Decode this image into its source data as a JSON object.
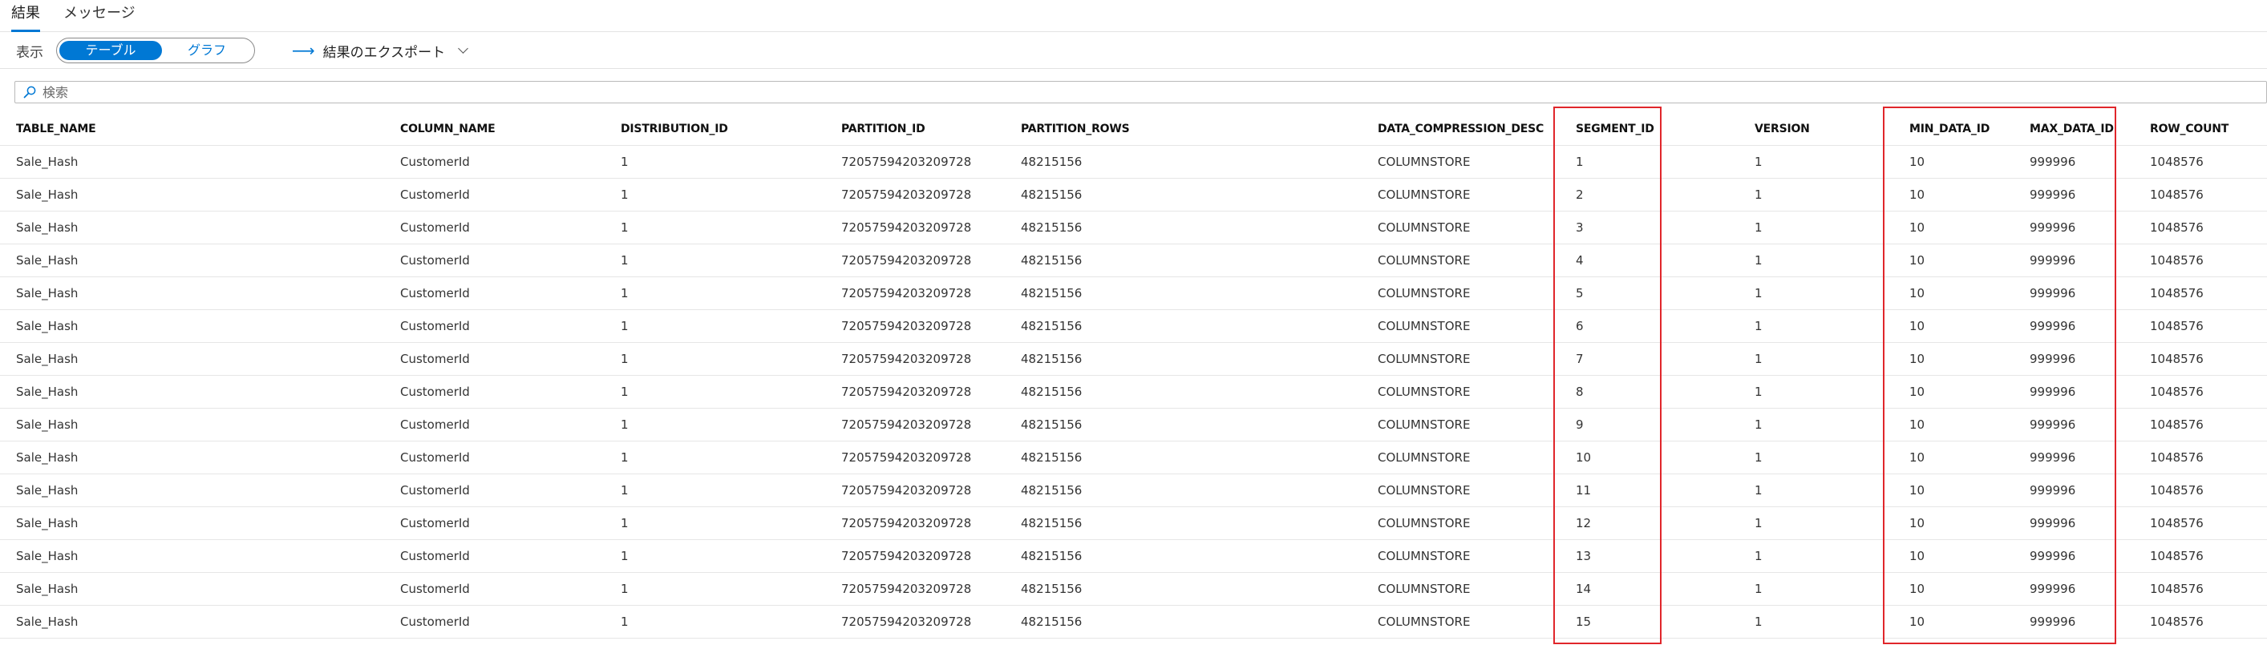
{
  "tabs": {
    "results": "結果",
    "messages": "メッセージ"
  },
  "view": {
    "label": "表示",
    "table_option": "テーブル",
    "chart_option": "グラフ",
    "export_label": "結果のエクスポート"
  },
  "search": {
    "placeholder": "検索"
  },
  "colors": {
    "accent": "#0078d4",
    "highlight": "#e0262b"
  },
  "table": {
    "columns": [
      "TABLE_NAME",
      "COLUMN_NAME",
      "DISTRIBUTION_ID",
      "PARTITION_ID",
      "PARTITION_ROWS",
      "DATA_COMPRESSION_DESC",
      "SEGMENT_ID",
      "VERSION",
      "MIN_DATA_ID",
      "MAX_DATA_ID",
      "ROW_COUNT"
    ],
    "highlighted_columns": [
      "SEGMENT_ID",
      "MIN_DATA_ID",
      "MAX_DATA_ID"
    ],
    "rows": [
      [
        "Sale_Hash",
        "CustomerId",
        "1",
        "72057594203209728",
        "48215156",
        "COLUMNSTORE",
        "1",
        "1",
        "10",
        "999996",
        "1048576"
      ],
      [
        "Sale_Hash",
        "CustomerId",
        "1",
        "72057594203209728",
        "48215156",
        "COLUMNSTORE",
        "2",
        "1",
        "10",
        "999996",
        "1048576"
      ],
      [
        "Sale_Hash",
        "CustomerId",
        "1",
        "72057594203209728",
        "48215156",
        "COLUMNSTORE",
        "3",
        "1",
        "10",
        "999996",
        "1048576"
      ],
      [
        "Sale_Hash",
        "CustomerId",
        "1",
        "72057594203209728",
        "48215156",
        "COLUMNSTORE",
        "4",
        "1",
        "10",
        "999996",
        "1048576"
      ],
      [
        "Sale_Hash",
        "CustomerId",
        "1",
        "72057594203209728",
        "48215156",
        "COLUMNSTORE",
        "5",
        "1",
        "10",
        "999996",
        "1048576"
      ],
      [
        "Sale_Hash",
        "CustomerId",
        "1",
        "72057594203209728",
        "48215156",
        "COLUMNSTORE",
        "6",
        "1",
        "10",
        "999996",
        "1048576"
      ],
      [
        "Sale_Hash",
        "CustomerId",
        "1",
        "72057594203209728",
        "48215156",
        "COLUMNSTORE",
        "7",
        "1",
        "10",
        "999996",
        "1048576"
      ],
      [
        "Sale_Hash",
        "CustomerId",
        "1",
        "72057594203209728",
        "48215156",
        "COLUMNSTORE",
        "8",
        "1",
        "10",
        "999996",
        "1048576"
      ],
      [
        "Sale_Hash",
        "CustomerId",
        "1",
        "72057594203209728",
        "48215156",
        "COLUMNSTORE",
        "9",
        "1",
        "10",
        "999996",
        "1048576"
      ],
      [
        "Sale_Hash",
        "CustomerId",
        "1",
        "72057594203209728",
        "48215156",
        "COLUMNSTORE",
        "10",
        "1",
        "10",
        "999996",
        "1048576"
      ],
      [
        "Sale_Hash",
        "CustomerId",
        "1",
        "72057594203209728",
        "48215156",
        "COLUMNSTORE",
        "11",
        "1",
        "10",
        "999996",
        "1048576"
      ],
      [
        "Sale_Hash",
        "CustomerId",
        "1",
        "72057594203209728",
        "48215156",
        "COLUMNSTORE",
        "12",
        "1",
        "10",
        "999996",
        "1048576"
      ],
      [
        "Sale_Hash",
        "CustomerId",
        "1",
        "72057594203209728",
        "48215156",
        "COLUMNSTORE",
        "13",
        "1",
        "10",
        "999996",
        "1048576"
      ],
      [
        "Sale_Hash",
        "CustomerId",
        "1",
        "72057594203209728",
        "48215156",
        "COLUMNSTORE",
        "14",
        "1",
        "10",
        "999996",
        "1048576"
      ],
      [
        "Sale_Hash",
        "CustomerId",
        "1",
        "72057594203209728",
        "48215156",
        "COLUMNSTORE",
        "15",
        "1",
        "10",
        "999996",
        "1048576"
      ]
    ]
  }
}
